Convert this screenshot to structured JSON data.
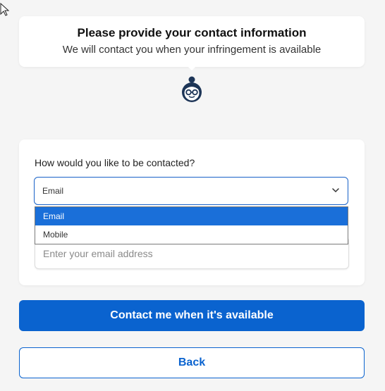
{
  "header": {
    "title": "Please provide your contact information",
    "subtitle": "We will contact you when your infringement is available"
  },
  "icons": {
    "cursor": "mouse-cursor-icon",
    "avatar": "agent-avatar-icon",
    "dropdown": "chevron-down-icon"
  },
  "form": {
    "question": "How would you like to be contacted?",
    "contact_method": {
      "selected": "Email",
      "options": [
        "Email",
        "Mobile"
      ],
      "highlighted_option": "Email"
    },
    "email": {
      "value": "",
      "placeholder": "Enter your email address"
    }
  },
  "actions": {
    "contact_label": "Contact me when it's available",
    "back_label": "Back"
  },
  "colors": {
    "accent": "#0a63cf",
    "highlight": "#1a6fd9",
    "background": "#f5f5f5",
    "avatar": "#1d3557"
  }
}
